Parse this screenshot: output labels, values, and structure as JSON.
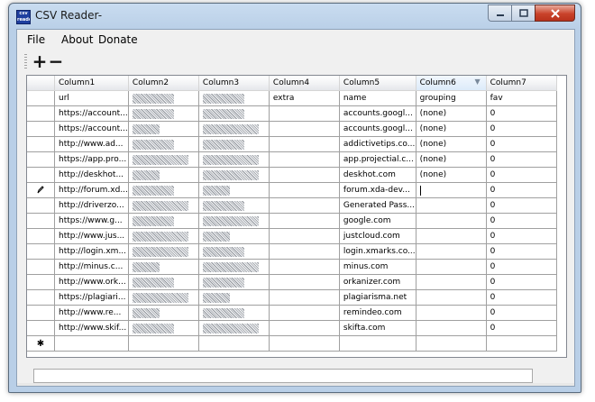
{
  "window": {
    "title": "CSV Reader-",
    "icon_label": "csv reader"
  },
  "menu": [
    "File",
    "About",
    "Donate"
  ],
  "toolbar": {
    "add_label": "+",
    "remove_label": "−"
  },
  "grid": {
    "columns": [
      "Column1",
      "Column2",
      "Column3",
      "Column4",
      "Column5",
      "Column6",
      "Column7"
    ],
    "sorted_column": "Column6",
    "rows": [
      {
        "marker": "",
        "cells": [
          "url",
          "",
          "",
          "extra",
          "name",
          "grouping",
          "fav"
        ]
      },
      {
        "marker": "",
        "cells": [
          "https://account...",
          "",
          "",
          "",
          "accounts.googl...",
          "(none)",
          "0"
        ]
      },
      {
        "marker": "",
        "cells": [
          "https://account...",
          "",
          "",
          "",
          "accounts.googl...",
          "(none)",
          "0"
        ]
      },
      {
        "marker": "",
        "cells": [
          "http://www.ad...",
          "",
          "",
          "",
          "addictivetips.co...",
          "(none)",
          "0"
        ]
      },
      {
        "marker": "",
        "cells": [
          "https://app.pro...",
          "",
          "",
          "",
          "app.projectial.c...",
          "(none)",
          "0"
        ]
      },
      {
        "marker": "",
        "cells": [
          "http://deskhot...",
          "",
          "",
          "",
          "deskhot.com",
          "(none)",
          "0"
        ]
      },
      {
        "marker": "edit",
        "cells": [
          "http://forum.xd...",
          "",
          "",
          "",
          "forum.xda-dev...",
          "",
          "0"
        ]
      },
      {
        "marker": "",
        "cells": [
          "http://driverzo...",
          "",
          "",
          "",
          "Generated Pass...",
          "",
          "0"
        ]
      },
      {
        "marker": "",
        "cells": [
          "https://www.g...",
          "",
          "",
          "",
          "google.com",
          "",
          "0"
        ]
      },
      {
        "marker": "",
        "cells": [
          "http://www.jus...",
          "",
          "",
          "",
          "justcloud.com",
          "",
          "0"
        ]
      },
      {
        "marker": "",
        "cells": [
          "http://login.xm...",
          "",
          "",
          "",
          "login.xmarks.co...",
          "",
          "0"
        ]
      },
      {
        "marker": "",
        "cells": [
          "http://minus.c...",
          "",
          "",
          "",
          "minus.com",
          "",
          "0"
        ]
      },
      {
        "marker": "",
        "cells": [
          "http://www.ork...",
          "",
          "",
          "",
          "orkanizer.com",
          "",
          "0"
        ]
      },
      {
        "marker": "",
        "cells": [
          "https://plagiari...",
          "",
          "",
          "",
          "plagiarisma.net",
          "",
          "0"
        ]
      },
      {
        "marker": "",
        "cells": [
          "http://www.re...",
          "",
          "",
          "",
          "remindeo.com",
          "",
          "0"
        ]
      },
      {
        "marker": "",
        "cells": [
          "http://www.skif...",
          "",
          "",
          "",
          "skifta.com",
          "",
          "0"
        ]
      }
    ],
    "new_row_marker": "✱"
  }
}
